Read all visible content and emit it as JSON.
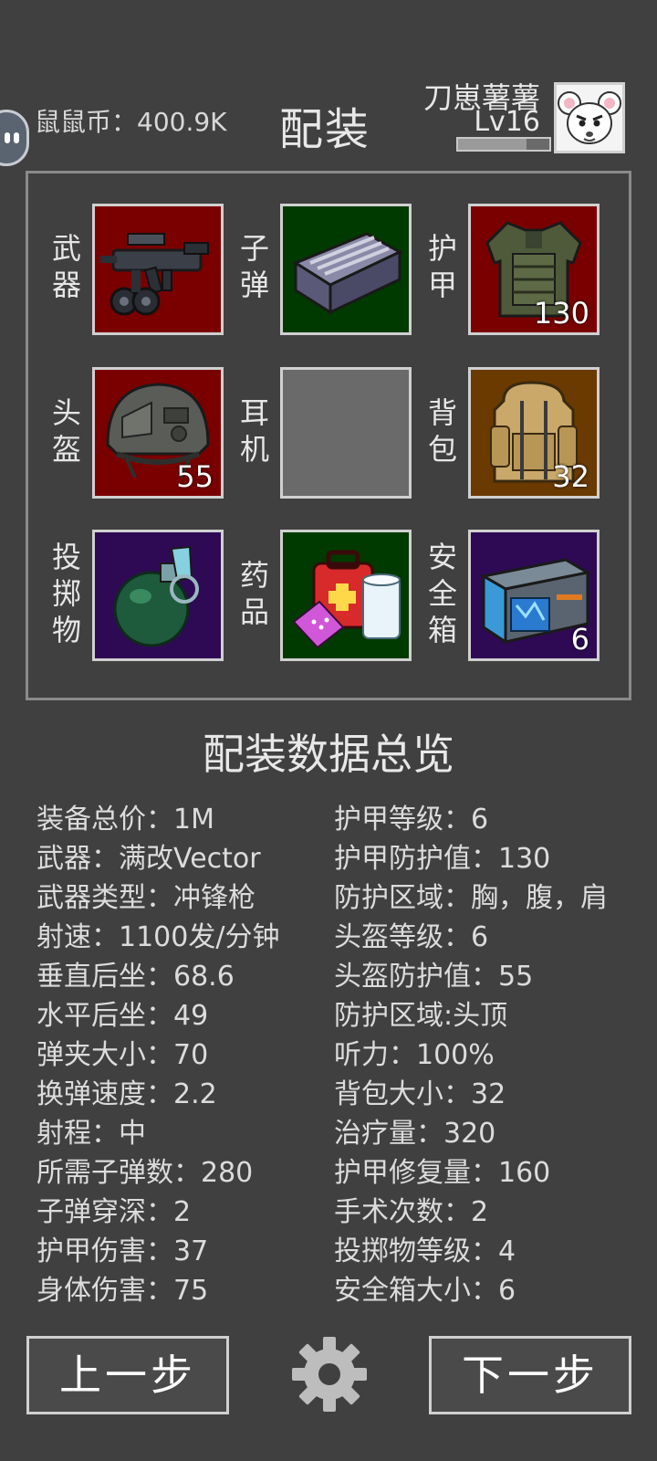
{
  "header": {
    "currency_label": "鼠鼠币：400.9K",
    "title": "配装",
    "player_name": "刀崽薯薯",
    "player_level": "Lv16",
    "xp_fraction": 0.75
  },
  "slots": [
    {
      "label": "武器",
      "count": "",
      "color": "#7a0000",
      "icon": "smg-weapon-icon"
    },
    {
      "label": "子弹",
      "count": "",
      "color": "#003a00",
      "icon": "ammo-box-icon"
    },
    {
      "label": "护甲",
      "count": "130",
      "color": "#7a0000",
      "icon": "body-armor-icon"
    },
    {
      "label": "头盔",
      "count": "55",
      "color": "#7a0000",
      "icon": "helmet-icon"
    },
    {
      "label": "耳机",
      "count": "",
      "color": "#6a6a6a",
      "icon": ""
    },
    {
      "label": "背包",
      "count": "32",
      "color": "#6a3a00",
      "icon": "backpack-icon"
    },
    {
      "label": "投掷物",
      "count": "",
      "color": "#2e0a55",
      "icon": "grenade-icon"
    },
    {
      "label": "药品",
      "count": "",
      "color": "#003a00",
      "icon": "medkit-icon"
    },
    {
      "label": "安全箱",
      "count": "6",
      "color": "#2e0a55",
      "icon": "safe-box-icon"
    }
  ],
  "summary": {
    "title": "配装数据总览",
    "left": [
      "装备总价：1M",
      "武器：满改Vector",
      "武器类型：冲锋枪",
      "射速：1100发/分钟",
      "垂直后坐：68.6",
      "水平后坐：49",
      "弹夹大小：70",
      "换弹速度：2.2",
      "射程：中",
      "所需子弹数：280",
      "子弹穿深：2",
      "护甲伤害：37",
      "身体伤害：75"
    ],
    "right": [
      "护甲等级：6",
      "护甲防护值：130",
      "防护区域：胸，腹，肩",
      "头盔等级：6",
      "头盔防护值：55",
      "防护区域:头顶",
      "听力：100%",
      "背包大小：32",
      "治疗量：320",
      "护甲修复量：160",
      "手术次数：2",
      "投掷物等级：4",
      "安全箱大小：6"
    ]
  },
  "footer": {
    "prev_label": "上一步",
    "next_label": "下一步"
  }
}
